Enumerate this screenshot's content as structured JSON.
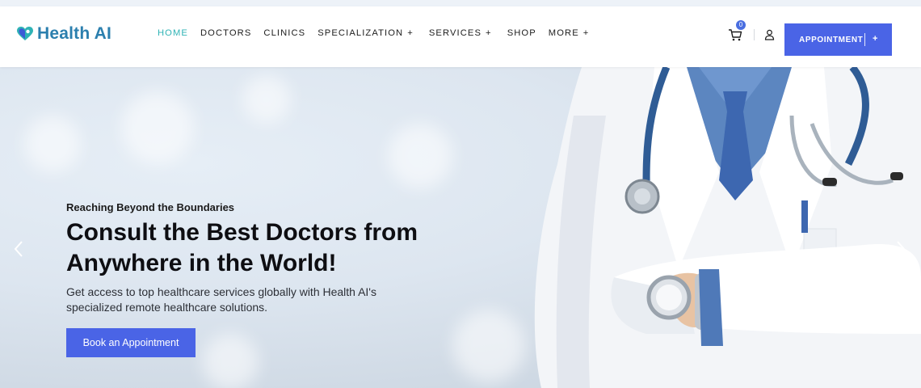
{
  "brand": {
    "name": "Health AI",
    "icon": "heart-logo-icon",
    "colors": {
      "teal": "#2fb3b5",
      "blue": "#2b7fae",
      "accent": "#4a64e6"
    }
  },
  "nav": {
    "items": [
      {
        "label": "HOME",
        "has_plus": false,
        "active": true
      },
      {
        "label": "DOCTORS",
        "has_plus": false,
        "active": false
      },
      {
        "label": "CLINICS",
        "has_plus": false,
        "active": false
      },
      {
        "label": "SPECIALIZATION",
        "has_plus": true,
        "active": false
      },
      {
        "label": "SERVICES",
        "has_plus": true,
        "active": false
      },
      {
        "label": "SHOP",
        "has_plus": false,
        "active": false
      },
      {
        "label": "MORE",
        "has_plus": true,
        "active": false
      }
    ],
    "plus_symbol": "+",
    "cart_count": "0",
    "appointment_label": "APPOINTMENT",
    "appointment_plus": "+"
  },
  "hero": {
    "eyebrow": "Reaching Beyond the Boundaries",
    "headline_line1": "Consult the Best Doctors from",
    "headline_line2": "Anywhere in the World!",
    "description_line1": "Get access to top healthcare services globally with Health AI's",
    "description_line2": "specialized remote healthcare solutions.",
    "cta_label": "Book an Appointment",
    "image": "doctor-with-stethoscope-photo"
  },
  "carousel": {
    "prev_icon": "chevron-left-icon",
    "next_icon": "chevron-right-icon"
  }
}
